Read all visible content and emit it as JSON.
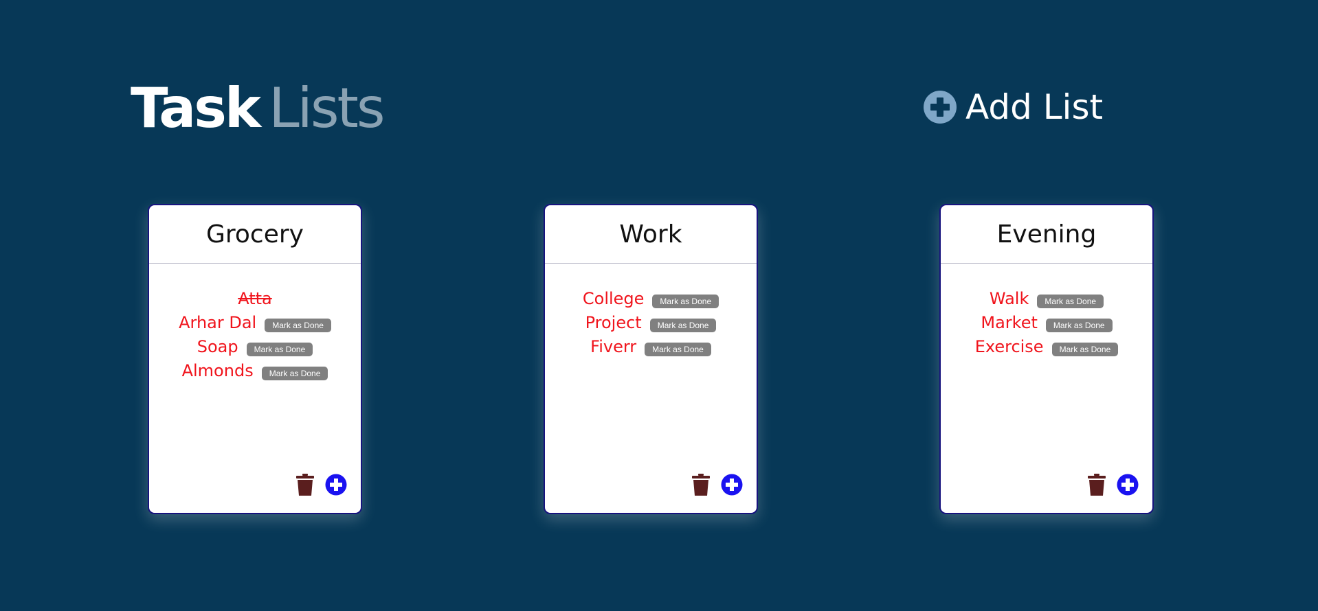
{
  "header": {
    "title_strong": "Task",
    "title_light": "Lists",
    "add_list_label": "Add List"
  },
  "colors": {
    "background": "#073857",
    "card_background": "#ffffff",
    "task_text": "#f0141c",
    "done_button": "#808080",
    "add_icon": "#1a12f0",
    "trash_icon": "#5a1e1e",
    "add_list_icon": "#7fa7c8"
  },
  "icons": {
    "add_list": "plus-circle-icon",
    "delete": "trash-icon",
    "add_task": "plus-circle-icon"
  },
  "lists": [
    {
      "title": "Grocery",
      "tasks": [
        {
          "name": "Atta",
          "done": true
        },
        {
          "name": "Arhar Dal",
          "done": false,
          "action": "Mark as Done"
        },
        {
          "name": "Soap",
          "done": false,
          "action": "Mark as Done"
        },
        {
          "name": "Almonds",
          "done": false,
          "action": "Mark as Done"
        }
      ]
    },
    {
      "title": "Work",
      "tasks": [
        {
          "name": "College",
          "done": false,
          "action": "Mark as Done"
        },
        {
          "name": "Project",
          "done": false,
          "action": "Mark as Done"
        },
        {
          "name": "Fiverr",
          "done": false,
          "action": "Mark as Done"
        }
      ]
    },
    {
      "title": "Evening",
      "tasks": [
        {
          "name": "Walk",
          "done": false,
          "action": "Mark as Done"
        },
        {
          "name": "Market",
          "done": false,
          "action": "Mark as Done"
        },
        {
          "name": "Exercise",
          "done": false,
          "action": "Mark as Done"
        }
      ]
    }
  ]
}
